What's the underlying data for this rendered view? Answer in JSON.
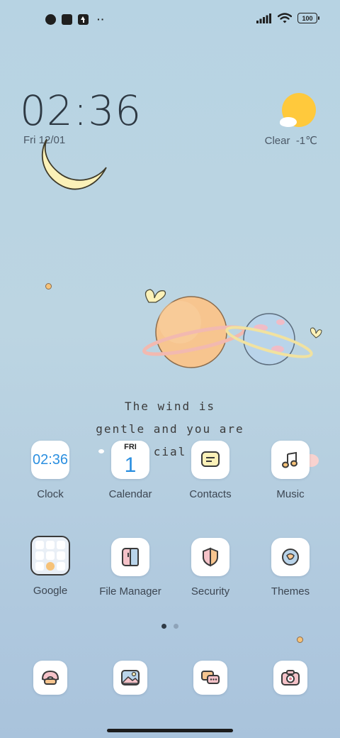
{
  "status_bar": {
    "battery": "100",
    "left_icons": [
      "notification-icon",
      "square-icon",
      "upload-icon"
    ],
    "more": "··"
  },
  "clock_widget": {
    "time": "02:36",
    "date": "Fri 12/01"
  },
  "weather_widget": {
    "condition": "Clear",
    "temperature": "-1℃"
  },
  "wallpaper_quote": {
    "line1": "The wind is",
    "line2": "gentle and you are",
    "line3": "cial"
  },
  "apps": {
    "clock": {
      "label": "Clock",
      "icon_text": "02:36"
    },
    "calendar": {
      "label": "Calendar",
      "day": "FRI",
      "date": "1"
    },
    "contacts": {
      "label": "Contacts"
    },
    "music": {
      "label": "Music"
    },
    "google": {
      "label": "Google"
    },
    "file_manager": {
      "label": "File Manager"
    },
    "security": {
      "label": "Security"
    },
    "themes": {
      "label": "Themes"
    }
  },
  "page_indicator": {
    "pages": 2,
    "current": 1
  },
  "colors": {
    "background_top": "#b7d3e3",
    "background_bottom": "#a9c3dc",
    "accent_blue": "#2b8fe0",
    "moon": "#fbf1b8",
    "sun": "#ffc93c"
  }
}
